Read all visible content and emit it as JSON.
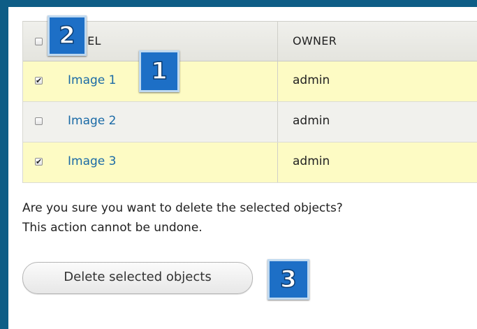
{
  "table": {
    "columns": {
      "label": "LABEL",
      "owner": "OWNER"
    },
    "select_all_checked": false,
    "rows": [
      {
        "label": "Image 1",
        "owner": "admin",
        "checked": true
      },
      {
        "label": "Image 2",
        "owner": "admin",
        "checked": false
      },
      {
        "label": "Image 3",
        "owner": "admin",
        "checked": true
      }
    ]
  },
  "confirmation": {
    "line1": "Are you sure you want to delete the selected objects?",
    "line2": "This action cannot be undone."
  },
  "actions": {
    "delete_label": "Delete selected objects"
  },
  "callouts": {
    "one": "1",
    "two": "2",
    "three": "3"
  },
  "colors": {
    "frame": "#0e5d86",
    "selected_row": "#fdfbc4",
    "unselected_row": "#f1f1ed",
    "link": "#1a6aa6",
    "callout": "#1d6fc6"
  },
  "icons": {
    "checked": "✔",
    "unchecked": ""
  }
}
